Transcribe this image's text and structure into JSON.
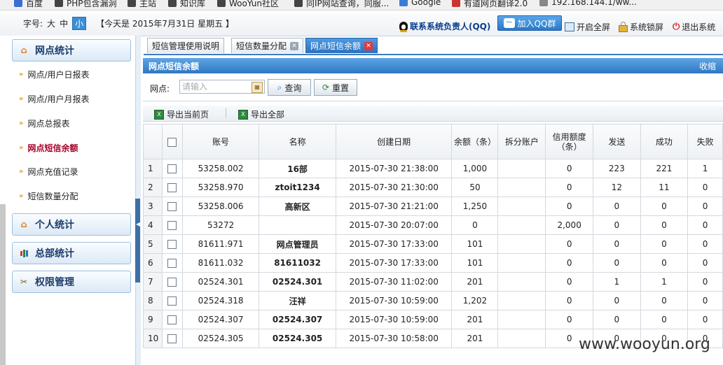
{
  "bookmarks": [
    {
      "label": "百度",
      "color": "#3b6fd0"
    },
    {
      "label": "PHP包含漏洞",
      "color": "#444"
    },
    {
      "label": "主站",
      "color": "#444"
    },
    {
      "label": "知识库",
      "color": "#444"
    },
    {
      "label": "WooYun社区",
      "color": "#444"
    },
    {
      "label": "同IP网站查询，同服...",
      "color": "#444"
    },
    {
      "label": "Google",
      "color": "#3b7bd6"
    },
    {
      "label": "有道网页翻译2.0",
      "color": "#c33"
    },
    {
      "label": "192.168.144.1/ww...",
      "color": "#888"
    }
  ],
  "topbar": {
    "font_label": "字号:",
    "font_opts": [
      "大",
      "中",
      "小"
    ],
    "date_text": "【今天是 2015年7月31日 星期五 】",
    "qq_contact": "联系系统负责人(QQ)",
    "qq_group": "加入QQ群",
    "fullscreen": "开启全屏",
    "lock": "系统锁屏",
    "logout": "退出系统"
  },
  "sidebar": {
    "sections": [
      {
        "label": "网点统计",
        "icon": "home-icon"
      },
      {
        "label": "个人统计",
        "icon": "home-icon"
      },
      {
        "label": "总部统计",
        "icon": "bar-chart-icon"
      },
      {
        "label": "权限管理",
        "icon": "tools-icon"
      }
    ],
    "items": [
      {
        "label": "网点/用户日报表",
        "active": false
      },
      {
        "label": "网点/用户月报表",
        "active": false
      },
      {
        "label": "网点总报表",
        "active": false
      },
      {
        "label": "网点短信余额",
        "active": true
      },
      {
        "label": "网点充值记录",
        "active": false
      },
      {
        "label": "短信数量分配",
        "active": false
      }
    ]
  },
  "tabs": [
    {
      "label": "短信管理使用说明",
      "closable": false,
      "active": false
    },
    {
      "label": "短信数量分配",
      "closable": true,
      "active": false
    },
    {
      "label": "网点短信余额",
      "closable": true,
      "active": true
    }
  ],
  "panel": {
    "title": "网点短信余额",
    "collapse": "收缩",
    "search_label": "网点:",
    "search_placeholder": "请输入",
    "query_btn": "查询",
    "reset_btn": "重置",
    "export_page": "导出当前页",
    "export_all": "导出全部"
  },
  "table": {
    "columns": [
      "",
      "",
      "账号",
      "名称",
      "创建日期",
      "余额（条）",
      "拆分账户",
      "信用额度（条）",
      "发送",
      "成功",
      "失败"
    ],
    "rows": [
      {
        "n": "1",
        "account": "53258.002",
        "name": "16部",
        "date": "2015-07-30 21:38:00",
        "balance": "1,000",
        "split": "",
        "credit": "0",
        "sent": "223",
        "success": "221",
        "fail": "1"
      },
      {
        "n": "2",
        "account": "53258.970",
        "name": "ztoit1234",
        "date": "2015-07-30 21:30:00",
        "balance": "50",
        "split": "",
        "credit": "0",
        "sent": "12",
        "success": "11",
        "fail": "0"
      },
      {
        "n": "3",
        "account": "53258.006",
        "name": "高新区",
        "date": "2015-07-30 21:21:00",
        "balance": "1,250",
        "split": "",
        "credit": "0",
        "sent": "0",
        "success": "0",
        "fail": "0"
      },
      {
        "n": "4",
        "account": "53272",
        "name": "",
        "date": "2015-07-30 20:07:00",
        "balance": "0",
        "split": "",
        "credit": "2,000",
        "sent": "0",
        "success": "0",
        "fail": "0"
      },
      {
        "n": "5",
        "account": "81611.971",
        "name": "网点管理员",
        "date": "2015-07-30 17:33:00",
        "balance": "101",
        "split": "",
        "credit": "0",
        "sent": "0",
        "success": "0",
        "fail": "0"
      },
      {
        "n": "6",
        "account": "81611.032",
        "name": "81611032",
        "date": "2015-07-30 17:33:00",
        "balance": "101",
        "split": "",
        "credit": "0",
        "sent": "0",
        "success": "0",
        "fail": "0"
      },
      {
        "n": "7",
        "account": "02524.301",
        "name": "02524.301",
        "date": "2015-07-30 11:02:00",
        "balance": "201",
        "split": "",
        "credit": "0",
        "sent": "1",
        "success": "1",
        "fail": "0"
      },
      {
        "n": "8",
        "account": "02524.318",
        "name": "汪祥",
        "date": "2015-07-30 10:59:00",
        "balance": "1,202",
        "split": "",
        "credit": "0",
        "sent": "0",
        "success": "0",
        "fail": "0"
      },
      {
        "n": "9",
        "account": "02524.307",
        "name": "02524.307",
        "date": "2015-07-30 10:59:00",
        "balance": "201",
        "split": "",
        "credit": "0",
        "sent": "0",
        "success": "0",
        "fail": "0"
      },
      {
        "n": "10",
        "account": "02524.305",
        "name": "02524.305",
        "date": "2015-07-30 10:58:00",
        "balance": "201",
        "split": "",
        "credit": "0",
        "sent": "0",
        "success": "0",
        "fail": "0"
      }
    ]
  },
  "watermark": "www.wooyun.org"
}
